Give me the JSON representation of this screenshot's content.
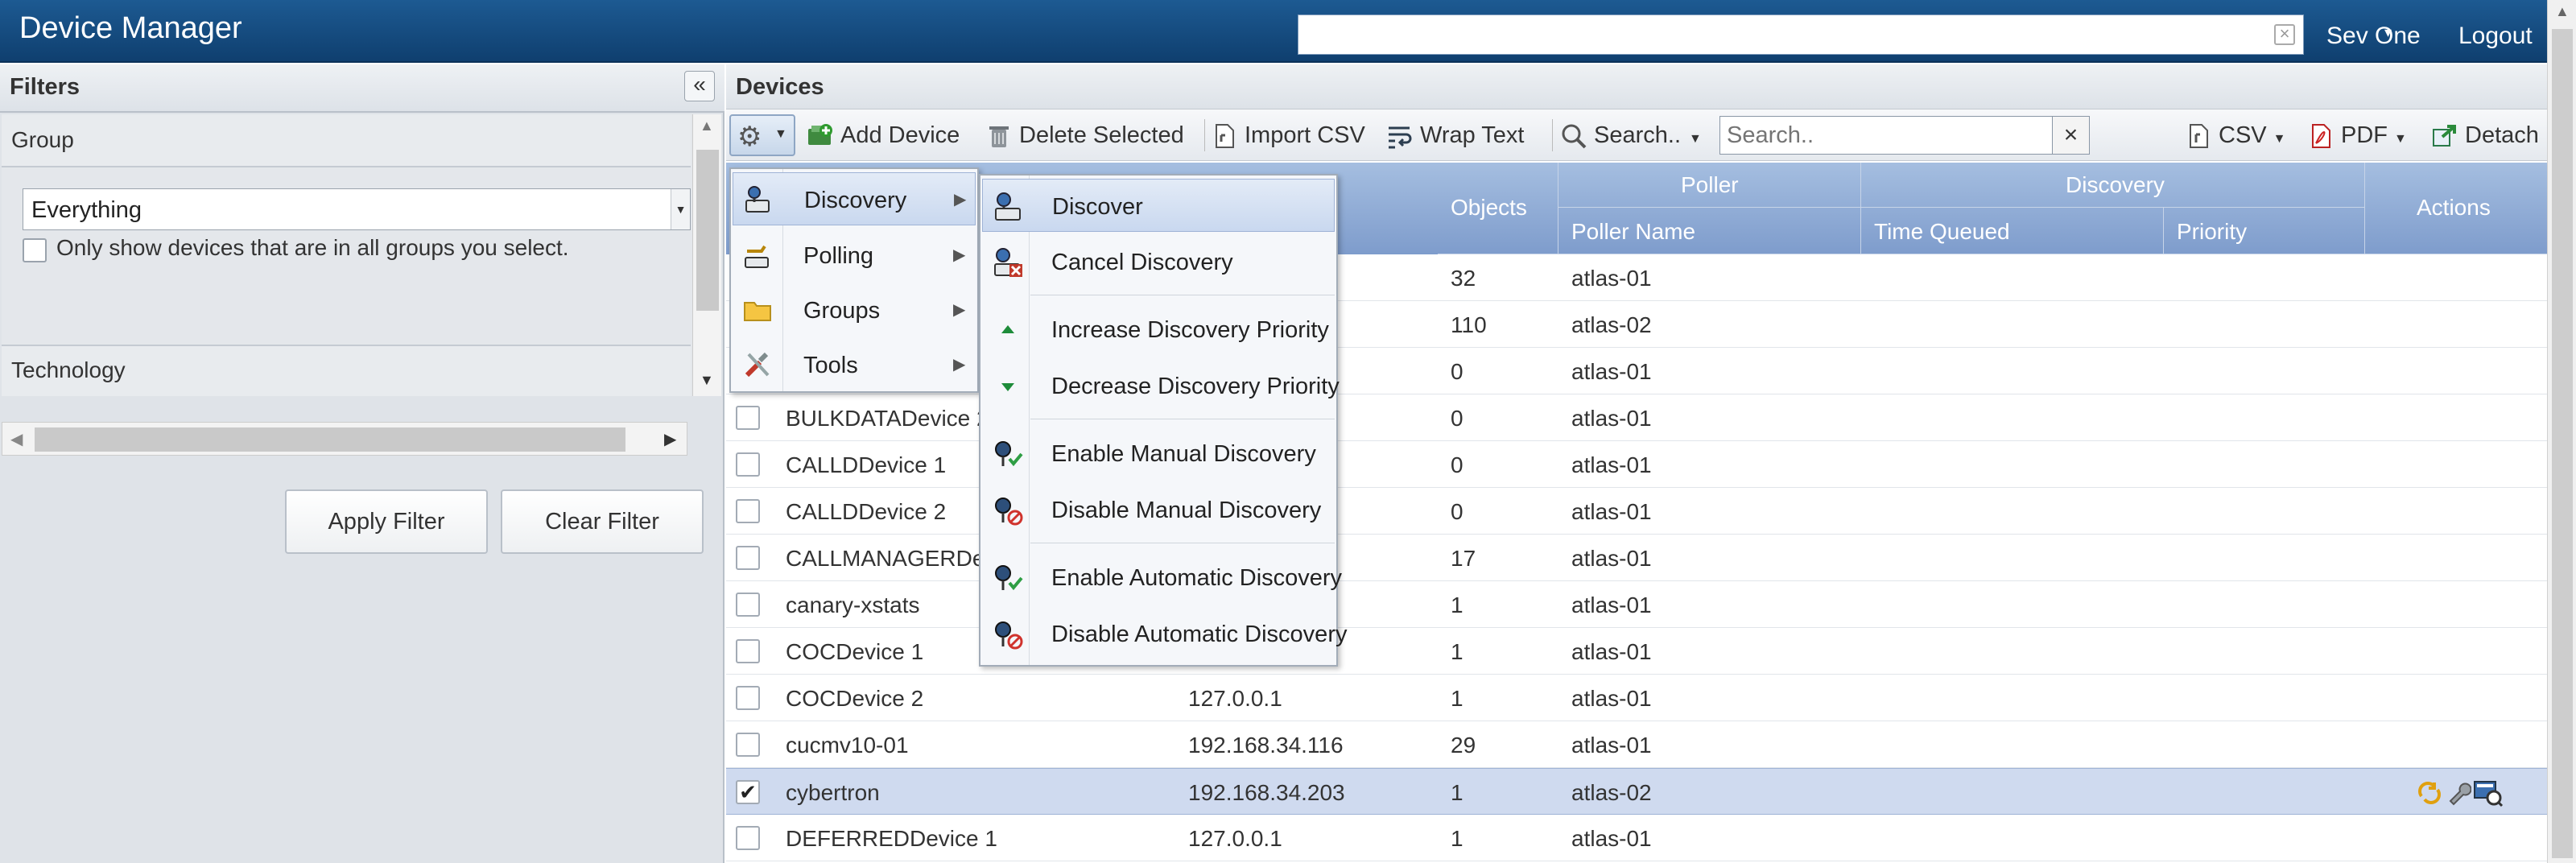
{
  "header": {
    "title": "Device Manager",
    "search_value": "",
    "user": "Sev One",
    "logout": "Logout"
  },
  "filters": {
    "title": "Filters",
    "group_label": "Group",
    "group_value": "Everything",
    "only_show_label": "Only show devices that are in all groups you select.",
    "technology_label": "Technology",
    "apply": "Apply Filter",
    "clear": "Clear Filter"
  },
  "devices": {
    "title": "Devices",
    "toolbar": {
      "add_device": "Add Device",
      "delete_selected": "Delete Selected",
      "import_csv": "Import CSV",
      "wrap_text": "Wrap Text",
      "search_menu": "Search..",
      "search_placeholder": "Search..",
      "csv": "CSV",
      "pdf": "PDF",
      "detach": "Detach"
    },
    "columns": {
      "objects": "Objects",
      "poller": "Poller",
      "poller_name": "Poller Name",
      "discovery": "Discovery",
      "time_queued": "Time Queued",
      "priority": "Priority",
      "actions": "Actions"
    },
    "rows": [
      {
        "name": "",
        "ip": "",
        "objects": "32",
        "poller": "atlas-01",
        "checked": false
      },
      {
        "name": "",
        "ip": "",
        "objects": "110",
        "poller": "atlas-02",
        "checked": false
      },
      {
        "name": "",
        "ip": "",
        "objects": "0",
        "poller": "atlas-01",
        "checked": false
      },
      {
        "name": "BULKDATADevice 2",
        "ip": "",
        "objects": "0",
        "poller": "atlas-01",
        "checked": false
      },
      {
        "name": "CALLDDevice 1",
        "ip": "",
        "objects": "0",
        "poller": "atlas-01",
        "checked": false
      },
      {
        "name": "CALLDDevice 2",
        "ip": "",
        "objects": "0",
        "poller": "atlas-01",
        "checked": false
      },
      {
        "name": "CALLMANAGERDevi",
        "ip": "",
        "objects": "17",
        "poller": "atlas-01",
        "checked": false
      },
      {
        "name": "canary-xstats",
        "ip": "",
        "objects": "1",
        "poller": "atlas-01",
        "checked": false
      },
      {
        "name": "COCDevice 1",
        "ip": "",
        "objects": "1",
        "poller": "atlas-01",
        "checked": false
      },
      {
        "name": "COCDevice 2",
        "ip": "127.0.0.1",
        "objects": "1",
        "poller": "atlas-01",
        "checked": false
      },
      {
        "name": "cucmv10-01",
        "ip": "192.168.34.116",
        "objects": "29",
        "poller": "atlas-01",
        "checked": false
      },
      {
        "name": "cybertron",
        "ip": "192.168.34.203",
        "objects": "1",
        "poller": "atlas-02",
        "checked": true
      },
      {
        "name": "DEFERREDDevice 1",
        "ip": "127.0.0.1",
        "objects": "1",
        "poller": "atlas-01",
        "checked": false
      }
    ]
  },
  "context_menu": {
    "items": [
      {
        "label": "Discovery",
        "icon": "discovery-icon"
      },
      {
        "label": "Polling",
        "icon": "polling-icon"
      },
      {
        "label": "Groups",
        "icon": "folder-icon"
      },
      {
        "label": "Tools",
        "icon": "tools-icon"
      }
    ]
  },
  "discovery_submenu": {
    "items": [
      {
        "label": "Discover",
        "icon": "discover-icon"
      },
      {
        "label": "Cancel Discovery",
        "icon": "cancel-discovery-icon"
      },
      {
        "label": "Increase Discovery Priority",
        "icon": "arrow-up-icon"
      },
      {
        "label": "Decrease Discovery Priority",
        "icon": "arrow-down-icon"
      },
      {
        "label": "Enable Manual Discovery",
        "icon": "enable-manual-icon"
      },
      {
        "label": "Disable Manual Discovery",
        "icon": "disable-manual-icon"
      },
      {
        "label": "Enable Automatic Discovery",
        "icon": "enable-auto-icon"
      },
      {
        "label": "Disable Automatic Discovery",
        "icon": "disable-auto-icon"
      }
    ]
  },
  "colors": {
    "header_bg": "#0f3f6f",
    "grid_header": "#7e9ccc",
    "selected_row": "#cfdaef"
  }
}
